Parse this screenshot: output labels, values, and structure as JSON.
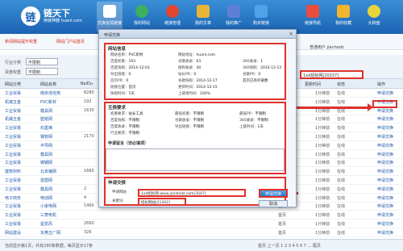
{
  "app": {
    "logo_title": "链天下",
    "logo_sub": "换链神器 huanl.com"
  },
  "nav": [
    {
      "label": "交换友情链接"
    },
    {
      "label": "我的网站"
    },
    {
      "label": "链接管理"
    },
    {
      "label": "我的文章"
    },
    {
      "label": "我的推广"
    },
    {
      "label": "购买链接"
    },
    {
      "label": "链接导航"
    },
    {
      "label": "我的收藏"
    },
    {
      "label": "大转盘"
    }
  ],
  "notice": {
    "left": "新闻网站提升权重",
    "mid": "网站门户站首页",
    "user": "普通用户 jianhedz"
  },
  "filter": {
    "label1": "行业分类",
    "val1": "不限制",
    "label2": "百度权重",
    "val2": "不限制",
    "search_value": "1xd招标网[20237]"
  },
  "table": {
    "headers": [
      "网站分类",
      "网站名称",
      "BaiDu",
      "",
      "",
      "",
      "",
      "",
      "",
      "",
      "",
      "首页",
      "更新时间",
      "状态",
      "操作"
    ],
    "rows": [
      {
        "cat": "工业贸易",
        "name": "南京佳信苑",
        "pr": "8280",
        "page": "首页",
        "time": "1分钟前",
        "status": "在线",
        "op": "申请交换"
      },
      {
        "cat": "机械五金",
        "name": "PVC新材",
        "pr": "192",
        "page": "首页",
        "time": "1分钟前",
        "status": "在线",
        "op": "申请交换"
      },
      {
        "cat": "工业贸易",
        "name": "模具网",
        "pr": "1630",
        "page": "首页",
        "time": "1分钟前",
        "status": "在线",
        "op": "申请交换"
      },
      {
        "cat": "机械五金",
        "name": "壁纸网",
        "pr": "",
        "page": "首页",
        "time": "1分钟前",
        "status": "在线",
        "op": "申请交换"
      },
      {
        "cat": "工业贸易",
        "name": "石墨烯",
        "pr": "",
        "page": "首页",
        "time": "1分钟前",
        "status": "在线",
        "op": "申请交换"
      },
      {
        "cat": "工业贸易",
        "name": "钢管网",
        "pr": "2170",
        "page": "首页",
        "time": "1分钟前",
        "status": "在线",
        "op": "申请交换"
      },
      {
        "cat": "工业贸易",
        "name": "半导网",
        "pr": "",
        "page": "首页",
        "time": "1分钟前",
        "status": "在线",
        "op": "申请交换"
      },
      {
        "cat": "工业贸易",
        "name": "模具网",
        "pr": "",
        "page": "首页",
        "time": "1分钟前",
        "status": "在线",
        "op": "申请交换"
      },
      {
        "cat": "工业贸易",
        "name": "铸钢网",
        "pr": "",
        "page": "首页",
        "time": "1分钟前",
        "status": "在线",
        "op": "申请交换"
      },
      {
        "cat": "建筑材料",
        "name": "北京镍网",
        "pr": "1660",
        "page": "首页",
        "time": "1分钟前",
        "status": "在线",
        "op": "申请交换"
      },
      {
        "cat": "工业贸易",
        "name": "雷盾网",
        "pr": "",
        "page": "首页",
        "time": "1分钟前",
        "status": "在线",
        "op": "申请交换"
      },
      {
        "cat": "工业贸易",
        "name": "模具网",
        "pr": "2",
        "page": "首页",
        "time": "1分钟前",
        "status": "在线",
        "op": "申请交换"
      },
      {
        "cat": "电子商务",
        "name": "电动网",
        "pr": "4",
        "page": "首页",
        "time": "1分钟前",
        "status": "在线",
        "op": "申请交换"
      },
      {
        "cat": "工业贸易",
        "name": "小家电网",
        "pr": "1460",
        "page": "首页",
        "time": "1分钟前",
        "status": "在线",
        "op": "申请交换"
      },
      {
        "cat": "工业贸易",
        "name": "三菱电机",
        "pr": "",
        "page": "首页",
        "time": "1分钟前",
        "status": "在线",
        "op": "申请交换"
      },
      {
        "cat": "工业贸易",
        "name": "星凯风",
        "pr": "2660",
        "page": "首页",
        "time": "1分钟前",
        "status": "在线",
        "op": "申请交换"
      },
      {
        "cat": "网站建设",
        "name": "东莞五厂网",
        "pr": "326",
        "page": "首页",
        "time": "1分钟前",
        "status": "在线",
        "op": "申请交换"
      }
    ]
  },
  "footer": {
    "left": "当前显示第1页，共有290条数据，每页显示17条",
    "pages": "首页 上一页 1 2 3 4 5 6 7 ... 尾页"
  },
  "dialog": {
    "title": "申请交换",
    "sec1_title": "网站信息",
    "sec1_items": [
      {
        "k": "网站名称：",
        "v": "PVC新材"
      },
      {
        "k": "网站地址：",
        "v": "huanl.com"
      },
      {
        "k": "百度权重：",
        "v": "193"
      },
      {
        "k": "谷歌收录：",
        "v": "63"
      },
      {
        "k": "360收录：",
        "v": "1"
      },
      {
        "k": "百度快照：",
        "v": "2014-12-03"
      },
      {
        "k": "搜狗收录：",
        "v": "40"
      },
      {
        "k": "360快照：",
        "v": "2014-12-12"
      },
      {
        "k": "导出链接：",
        "v": "0"
      },
      {
        "k": "站长PR：",
        "v": "0"
      },
      {
        "k": "谷歌PR：",
        "v": "0"
      },
      {
        "k": "首页PR：",
        "v": "0"
      },
      {
        "k": "谷歌快照：",
        "v": "2014-12-17"
      },
      {
        "k": "",
        "v": "首页已有外链数"
      },
      {
        "k": "链接位置：",
        "v": "首页"
      },
      {
        "k": "更新时间：",
        "v": "2014-12-15"
      },
      {
        "k": "快照时间：",
        "v": "5天"
      },
      {
        "k": "上链接时间：",
        "v": "100%"
      }
    ],
    "sec2_title": "互换要求",
    "sec2_items": [
      {
        "k": "权重要求：",
        "v": "站长工具"
      },
      {
        "k": "最低权重：",
        "v": "不限制"
      },
      {
        "k": "最低PR：",
        "v": "不限制"
      },
      {
        "k": "百度快照：",
        "v": "不限制"
      },
      {
        "k": "谷歌收录：",
        "v": "不限制"
      },
      {
        "k": "360收录：",
        "v": "不限制"
      },
      {
        "k": "百度收录：",
        "v": "不限制"
      },
      {
        "k": "导出链接：",
        "v": "不限制"
      },
      {
        "k": "上链时间：",
        "v": "1天"
      },
      {
        "k": "行业要求：",
        "v": "不限制"
      }
    ],
    "sec2_note": "申请留言（非必填项）",
    "sec3_title": "申请交换",
    "link_label": "申请网站",
    "link_value": "1xd招标网-www.jianhedz.com[3507]",
    "kw_label": "关键词",
    "kw_value": "招标网站[21302]",
    "apply_label": "申请交换",
    "cancel_label": "取消"
  }
}
